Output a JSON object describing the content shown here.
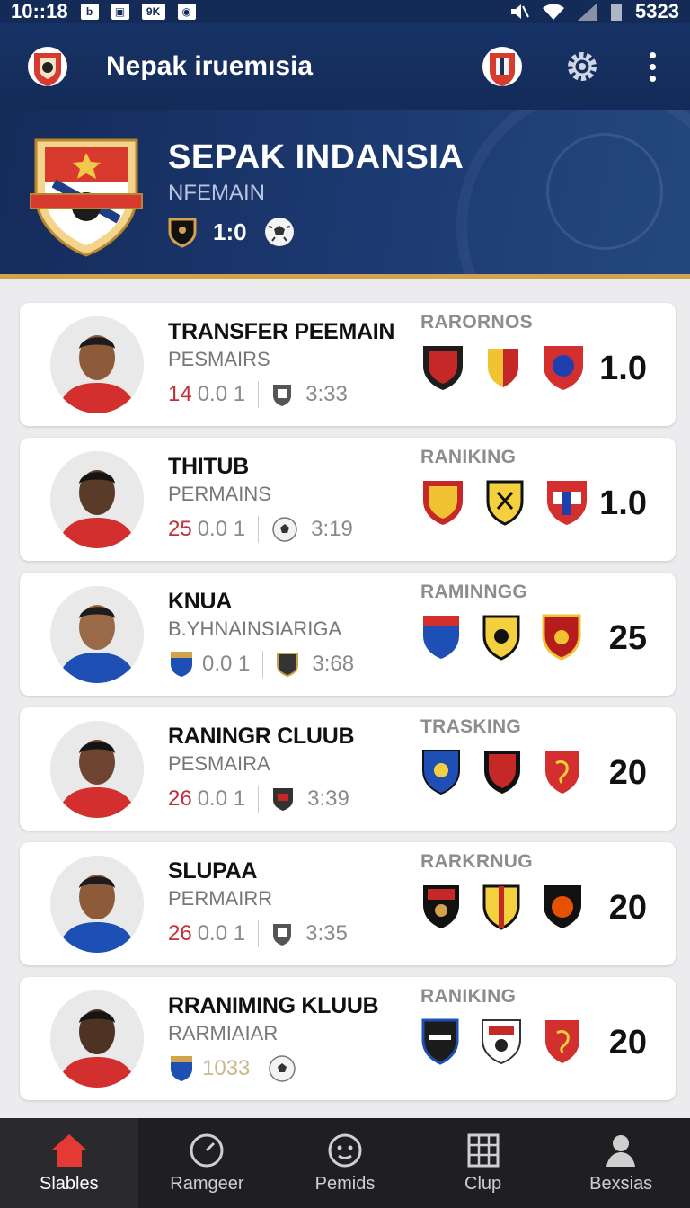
{
  "status": {
    "time": "10::18",
    "icons": [
      "b-icon",
      "image-icon",
      "9k-icon",
      "camera-icon"
    ],
    "right_value": "5323"
  },
  "appbar": {
    "title": "Nepak iruemısia"
  },
  "hero": {
    "title": "SEPAK INDANSIA",
    "subtitle": "NFEMAIN",
    "score": "1:0"
  },
  "cards": [
    {
      "name": "TRANSFER PEEMAIN",
      "sub": "PESMAIRS",
      "num": "14",
      "val": "0.0 1",
      "time": "3:33",
      "rank_label": "RARORNOS",
      "score": "1.0",
      "shirt": "red"
    },
    {
      "name": "THITUB",
      "sub": "PERMAINS",
      "num": "25",
      "val": "0.0 1",
      "time": "3:19",
      "rank_label": "RANIKING",
      "score": "1.0",
      "shirt": "red"
    },
    {
      "name": "KNUA",
      "sub": "B.YHNAINSIARIGA",
      "num": "",
      "val": "0.0 1",
      "time": "3:68",
      "rank_label": "RAMINNGG",
      "score": "25",
      "shirt": "blue"
    },
    {
      "name": "RANINGR CLUUB",
      "sub": "PESMAIRA",
      "num": "26",
      "val": "0.0 1",
      "time": "3:39",
      "rank_label": "TRASKING",
      "score": "20",
      "shirt": "red"
    },
    {
      "name": "SLUPAA",
      "sub": "PERMAIRR",
      "num": "26",
      "val": "0.0 1",
      "time": "3:35",
      "rank_label": "RARKRNUG",
      "score": "20",
      "shirt": "blue"
    },
    {
      "name": "RRANIMING KLUUB",
      "sub": "RARMIAIAR",
      "num": "",
      "val": "1033",
      "time": "",
      "rank_label": "RANIKING",
      "score": "20",
      "shirt": "red"
    }
  ],
  "nav": [
    {
      "label": "Slables",
      "icon": "home-icon"
    },
    {
      "label": "Ramgeer",
      "icon": "gauge-icon"
    },
    {
      "label": "Pemids",
      "icon": "smiley-icon"
    },
    {
      "label": "Clup",
      "icon": "grid-icon"
    },
    {
      "label": "Bexsias",
      "icon": "person-icon"
    }
  ],
  "colors": {
    "header": "#142a57",
    "accent": "#d2a24c",
    "score_red": "#c0303a",
    "nav_bg": "#1f1f23"
  }
}
